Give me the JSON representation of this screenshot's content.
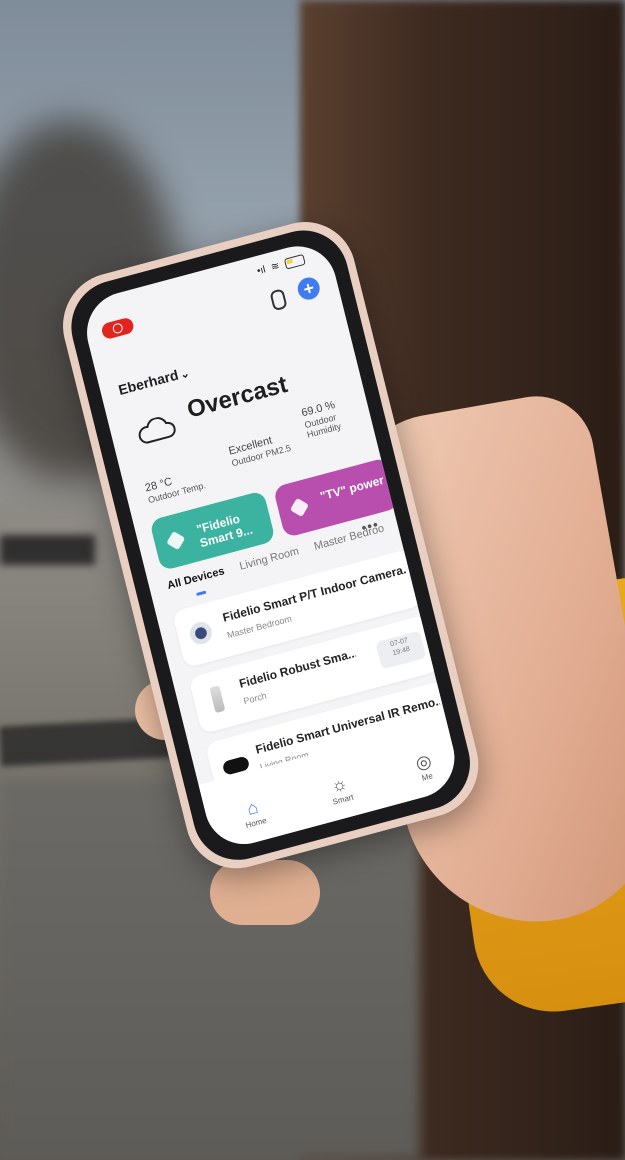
{
  "status": {
    "signal": "•ıl",
    "wifi": "≋"
  },
  "header": {
    "home_name": "Eberhard",
    "chevron": "⌄"
  },
  "weather": {
    "condition": "Overcast",
    "temperature": "28 °C",
    "temperature_label": "Outdoor Temp.",
    "air_quality": "Excellent",
    "air_quality_label": "Outdoor PM2.5",
    "humidity": "69.0 %",
    "humidity_label": "Outdoor Humidity"
  },
  "scenes": [
    {
      "label": "\"Fidelio Smart 9...",
      "color": "#3bb3a0"
    },
    {
      "label": "\"TV\" power",
      "color": "#b84fae"
    }
  ],
  "tabs": [
    "All Devices",
    "Living Room",
    "Master Bedroo"
  ],
  "more_label": "•••",
  "devices": [
    {
      "name": "Fidelio Smart P/T Indoor Camera...",
      "room": "Master Bedroom",
      "status_top": "",
      "status_bottom": ""
    },
    {
      "name": "Fidelio Robust Sma...",
      "room": "Porch",
      "status_top": "07-07",
      "status_bottom": "19:48"
    },
    {
      "name": "Fidelio Smart Universal IR Remo...",
      "room": "Living Room",
      "status_top": "",
      "status_bottom": ""
    }
  ],
  "tabbar": {
    "home": "Home",
    "smart": "Smart",
    "me": "Me"
  },
  "colors": {
    "accent": "#3f7cf0",
    "record": "#e0251f"
  }
}
